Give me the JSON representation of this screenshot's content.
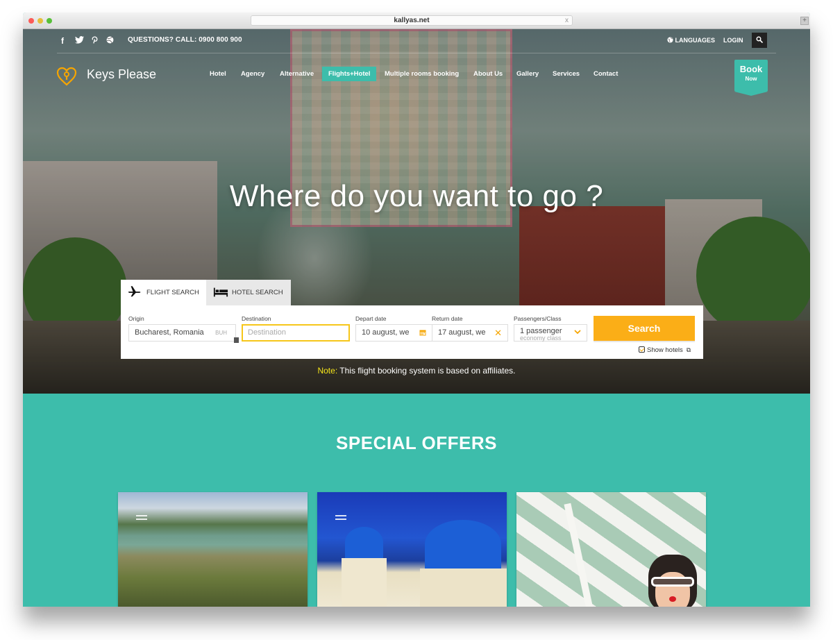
{
  "browser": {
    "url": "kallyas.net",
    "close_glyph": "x",
    "newtab_glyph": "+"
  },
  "topbar": {
    "social": [
      {
        "name": "facebook-icon",
        "glyph": "f"
      },
      {
        "name": "twitter-icon",
        "glyph": "t"
      },
      {
        "name": "pinterest-icon",
        "glyph": "p"
      },
      {
        "name": "dribbble-icon",
        "glyph": "d"
      }
    ],
    "contact_text": "QUESTIONS? CALL: 0900 800 900",
    "languages_label": "LANGUAGES",
    "login_label": "LOGIN"
  },
  "header": {
    "logo_text": "Keys Please",
    "nav": [
      {
        "label": "Hotel",
        "active": false
      },
      {
        "label": "Agency",
        "active": false
      },
      {
        "label": "Alternative",
        "active": false
      },
      {
        "label": "Flights+Hotel",
        "active": true
      },
      {
        "label": "Multiple rooms booking",
        "active": false
      },
      {
        "label": "About Us",
        "active": false
      },
      {
        "label": "Gallery",
        "active": false
      },
      {
        "label": "Services",
        "active": false
      },
      {
        "label": "Contact",
        "active": false
      }
    ],
    "book_now": {
      "line1": "Book",
      "line2": "Now"
    }
  },
  "hero": {
    "headline": "Where do you want to go ?"
  },
  "search": {
    "tabs": [
      {
        "label": "FLIGHT SEARCH",
        "icon": "airplane-icon",
        "active": true
      },
      {
        "label": "HOTEL SEARCH",
        "icon": "bed-icon",
        "active": false
      }
    ],
    "origin": {
      "label": "Origin",
      "value": "Bucharest, Romania",
      "code": "BUH"
    },
    "destination": {
      "label": "Destination",
      "placeholder": "Destination"
    },
    "depart": {
      "label": "Depart date",
      "value": "10 august, we"
    },
    "return": {
      "label": "Return date",
      "value": "17 august, we"
    },
    "passengers": {
      "label": "Passengers/Class",
      "line1": "1 passenger",
      "line2": "economy class"
    },
    "submit_label": "Search",
    "show_hotels_label": "Show hotels",
    "show_hotels_checked": true
  },
  "note": {
    "prefix": "Note:",
    "text": " This flight booking system is based on affiliates."
  },
  "offers": {
    "title": "SPECIAL OFFERS",
    "cards": [
      {
        "name": "offer-card-lake"
      },
      {
        "name": "offer-card-santorini"
      },
      {
        "name": "offer-card-umbrella"
      }
    ]
  },
  "colors": {
    "accent": "#3dbdab",
    "search_button": "#fbae17",
    "note_prefix": "#f6e61a",
    "destination_border": "#f6c619"
  }
}
